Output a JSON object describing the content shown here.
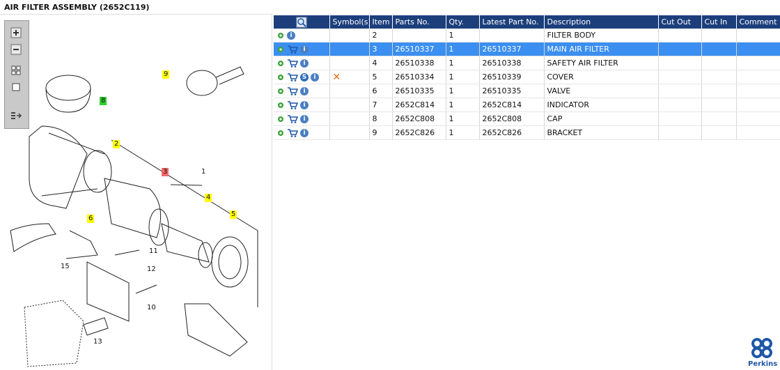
{
  "header": {
    "title": "AIR FILTER ASSEMBLY (2652C119)"
  },
  "toolbar": {
    "icons": [
      "zoom-in-icon",
      "zoom-out-icon",
      "thumbnails-icon",
      "fit-icon",
      "expand-panel-icon"
    ]
  },
  "diagram": {
    "callouts": [
      {
        "label": "9",
        "color": "yellow"
      },
      {
        "label": "8",
        "color": "green"
      },
      {
        "label": "2",
        "color": "yellow"
      },
      {
        "label": "3",
        "color": "red"
      },
      {
        "label": "4",
        "color": "yellow"
      },
      {
        "label": "5",
        "color": "yellow"
      },
      {
        "label": "6",
        "color": "yellow"
      }
    ],
    "numbers": [
      "1",
      "11",
      "12",
      "10",
      "13",
      "15"
    ]
  },
  "table": {
    "headers": [
      "Symbol(s)",
      "Item",
      "Parts No.",
      "Qty.",
      "Latest Part No.",
      "Description",
      "Cut Out",
      "Cut In",
      "Comment"
    ],
    "rows": [
      {
        "cart": false,
        "s": false,
        "item": "2",
        "part": "",
        "qty": "1",
        "latest": "",
        "desc": "FILTER BODY",
        "x": false
      },
      {
        "cart": true,
        "s": false,
        "item": "3",
        "part": "26510337",
        "qty": "1",
        "latest": "26510337",
        "desc": "MAIN AIR FILTER",
        "x": false
      },
      {
        "cart": true,
        "s": false,
        "item": "4",
        "part": "26510338",
        "qty": "1",
        "latest": "26510338",
        "desc": "SAFETY AIR FILTER",
        "x": false
      },
      {
        "cart": true,
        "s": true,
        "item": "5",
        "part": "26510334",
        "qty": "1",
        "latest": "26510339",
        "desc": "COVER",
        "x": true
      },
      {
        "cart": true,
        "s": false,
        "item": "6",
        "part": "26510335",
        "qty": "1",
        "latest": "26510335",
        "desc": "VALVE",
        "x": false
      },
      {
        "cart": true,
        "s": false,
        "item": "7",
        "part": "2652C814",
        "qty": "1",
        "latest": "2652C814",
        "desc": "INDICATOR",
        "x": false
      },
      {
        "cart": true,
        "s": false,
        "item": "8",
        "part": "2652C808",
        "qty": "1",
        "latest": "2652C808",
        "desc": "CAP",
        "x": false
      },
      {
        "cart": true,
        "s": false,
        "item": "9",
        "part": "2652C826",
        "qty": "1",
        "latest": "2652C826",
        "desc": "BRACKET",
        "x": false
      }
    ]
  },
  "symbols": {
    "supersede": "S",
    "info": "i"
  },
  "logo": {
    "text": "Perkins"
  },
  "colors": {
    "header_bg": "#1c3f7c",
    "selected_row": "#3b8ff0",
    "accent": "#1f58a7"
  }
}
